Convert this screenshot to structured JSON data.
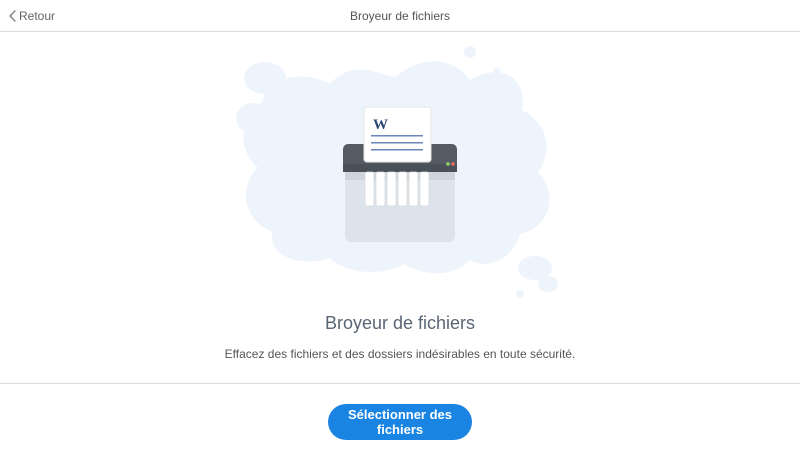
{
  "header": {
    "back_label": "Retour",
    "title": "Broyeur de fichiers"
  },
  "hero": {
    "illustration": "paper-shredder-icon",
    "document_logo": "W"
  },
  "main": {
    "title": "Broyeur de fichiers",
    "description": "Effacez des fichiers et des dossiers indésirables en toute sécurité."
  },
  "action": {
    "select_label": "Sélectionner des fichiers"
  },
  "colors": {
    "accent": "#1a84e3",
    "blob": "#eaf2fb",
    "title_text": "#5a6676"
  }
}
